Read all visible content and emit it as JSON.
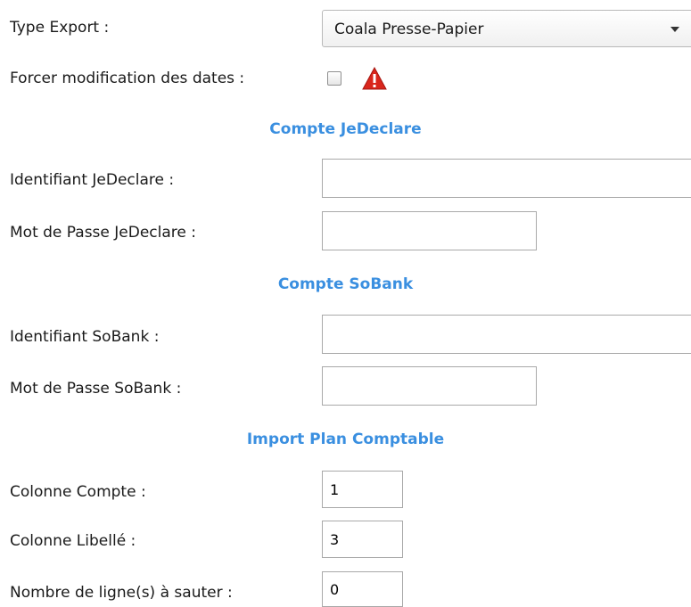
{
  "export": {
    "type_label": "Type Export :",
    "type_selected": "Coala Presse-Papier",
    "force_dates_label": "Forcer modification des dates :",
    "force_dates_checked": false
  },
  "jedeclare": {
    "section_title": "Compte JeDeclare",
    "id_label": "Identifiant JeDeclare :",
    "id_value": "",
    "password_label": "Mot de Passe JeDeclare :",
    "password_value": ""
  },
  "sobank": {
    "section_title": "Compte SoBank",
    "id_label": "Identifiant SoBank :",
    "id_value": "",
    "password_label": "Mot de Passe SoBank :",
    "password_value": ""
  },
  "import_plan": {
    "section_title": "Import Plan Comptable",
    "account_col_label": "Colonne Compte :",
    "account_col_value": "1",
    "label_col_label": "Colonne Libellé :",
    "label_col_value": "3",
    "skip_rows_label": "Nombre de ligne(s) à sauter :",
    "skip_rows_value": "0"
  },
  "icons": {
    "warning": "warning-triangle-icon",
    "dropdown": "chevron-down-icon"
  },
  "colors": {
    "section_title": "#3a8fe0",
    "warning": "#d9261c"
  }
}
